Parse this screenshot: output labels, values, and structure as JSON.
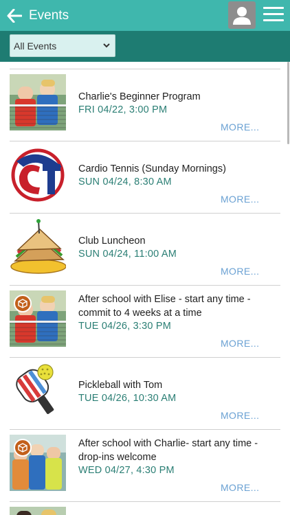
{
  "header": {
    "title": "Events",
    "bg_color": "#3fb7ad"
  },
  "filter": {
    "selected": "All Events",
    "bg_color": "#1e7c72"
  },
  "events": [
    {
      "name": "Charlie's Beginner Program",
      "when": "FRI 04/22, 3:00 PM",
      "more": "MORE...",
      "thumb": "kids-tennis-photo",
      "badge": false
    },
    {
      "name": "Cardio Tennis (Sunday Mornings)",
      "when": "SUN 04/24, 8:30 AM",
      "more": "MORE...",
      "thumb": "cardio-tennis-logo",
      "badge": false
    },
    {
      "name": "Club Luncheon",
      "when": "SUN 04/24, 11:00 AM",
      "more": "MORE...",
      "thumb": "sandwich-clipart",
      "badge": false
    },
    {
      "name": "After school with Elise - start any time - commit to 4 weeks at a time",
      "when": "TUE 04/26, 3:30 PM",
      "more": "MORE...",
      "thumb": "kids-tennis-photo",
      "badge": true
    },
    {
      "name": "Pickleball with Tom",
      "when": "TUE 04/26, 10:30 AM",
      "more": "MORE...",
      "thumb": "pickleball-paddle-clipart",
      "badge": false
    },
    {
      "name": "After school with Charlie- start any time - drop-ins welcome",
      "when": "WED 04/27, 4:30 PM",
      "more": "MORE...",
      "thumb": "kids-group-photo",
      "badge": true
    }
  ],
  "colors": {
    "accent": "#2a7e74",
    "link": "#6aa1d3"
  }
}
